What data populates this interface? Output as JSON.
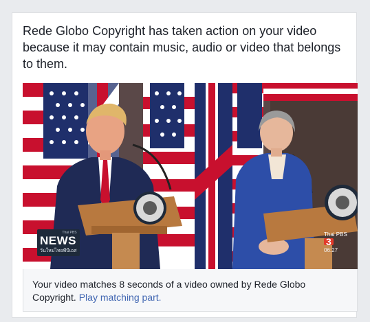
{
  "notice": {
    "message": "Rede Globo Copyright has taken action on your video because it may contain music, audio or video that belongs to them."
  },
  "video": {
    "news_logo_small": "Thai PBS",
    "news_logo_text": "NEWS",
    "news_logo_sub": "วันใหม่ไทยพีบีเอส",
    "channel_name": "Thai PBS",
    "channel_number": "3",
    "timestamp": "06:27"
  },
  "caption": {
    "text": "Your video matches 8 seconds of a video owned by Rede Globo Copyright.",
    "link_label": "Play matching part."
  },
  "colors": {
    "link": "#4267b2",
    "text": "#1d2129",
    "flag_red": "#c8102e",
    "flag_blue": "#1f2f6b",
    "suit_blue": "#2d4ea8",
    "podium": "#b8793f"
  }
}
